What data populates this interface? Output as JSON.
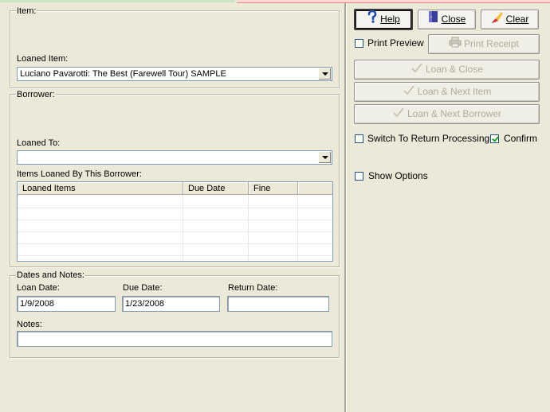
{
  "item_group": {
    "title": "Item:",
    "loaned_item_label": "Loaned Item:",
    "loaned_item_value": "Luciano Pavarotti: The Best (Farewell Tour)  SAMPLE"
  },
  "borrower_group": {
    "title": "Borrower:",
    "loaned_to_label": "Loaned To:",
    "loaned_to_value": "",
    "items_label": "Items Loaned By This Borrower:",
    "columns": [
      "Loaned Items",
      "Due Date",
      "Fine"
    ]
  },
  "dates_group": {
    "title": "Dates and Notes:",
    "loan_date_label": "Loan Date:",
    "loan_date_value": "1/9/2008",
    "due_date_label": "Due Date:",
    "due_date_value": "1/23/2008",
    "return_date_label": "Return Date:",
    "return_date_value": "",
    "notes_label": "Notes:",
    "notes_value": ""
  },
  "buttons": {
    "help": "Help",
    "close": "Close",
    "clear": "Clear",
    "print_receipt": "Print Receipt",
    "loan_close": "Loan & Close",
    "loan_next_item": "Loan & Next Item",
    "loan_next_borrower": "Loan & Next Borrower"
  },
  "options": {
    "print_preview": "Print Preview",
    "print_preview_checked": false,
    "switch_return": "Switch To Return Processing",
    "switch_return_checked": false,
    "confirm": "Confirm",
    "confirm_checked": true,
    "show_options": "Show Options",
    "show_options_checked": false
  },
  "colors": {
    "window_bg": "#ece9d8",
    "field_border": "#7f9db9"
  },
  "icons": {
    "help": "question-mark-icon",
    "close": "door-icon",
    "clear": "eraser-brush-icon",
    "print_receipt": "printer-icon",
    "loan": "checkmark-icon"
  }
}
